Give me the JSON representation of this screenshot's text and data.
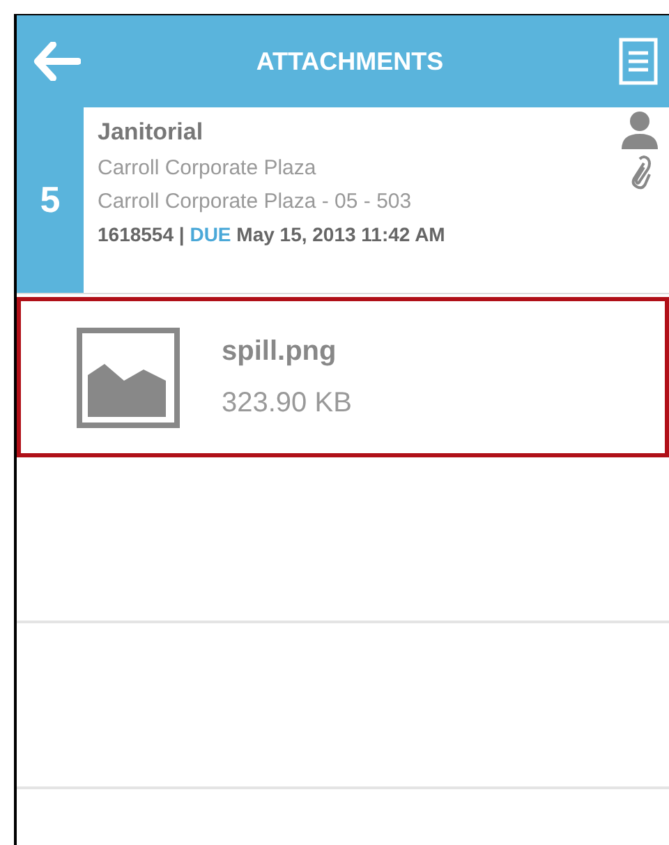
{
  "header": {
    "title": "ATTACHMENTS"
  },
  "work_order": {
    "number": "5",
    "title": "Janitorial",
    "location": "Carroll Corporate Plaza",
    "sublocation": "Carroll Corporate Plaza - 05 - 503",
    "id": "1618554 |",
    "due_label": "DUE",
    "due_date": "May 15, 2013 11:42 AM"
  },
  "attachments": [
    {
      "name": "spill.png",
      "size": "323.90 KB",
      "selected": true
    }
  ]
}
